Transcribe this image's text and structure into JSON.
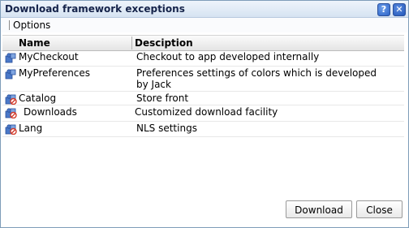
{
  "dialog": {
    "title": "Download framework exceptions",
    "help_glyph": "?",
    "close_glyph": "✕"
  },
  "menu": {
    "options_label": "Options"
  },
  "table": {
    "columns": [
      "Name",
      "Desciption"
    ],
    "rows": [
      {
        "name": "MyCheckout",
        "description": "Checkout to app developed internally",
        "icon": "puzzle-icon"
      },
      {
        "name": "MyPreferences",
        "description": "Preferences settings of colors which is developed by Jack",
        "icon": "puzzle-icon"
      },
      {
        "name": "Catalog",
        "description": "Store front",
        "icon": "puzzle-blocked-icon"
      },
      {
        "name": "Downloads",
        "description": "Customized download facility",
        "icon": "puzzle-blocked-icon"
      },
      {
        "name": "Lang",
        "description": "NLS settings",
        "icon": "puzzle-blocked-icon"
      }
    ]
  },
  "buttons": {
    "download_label": "Download",
    "close_label": "Close"
  },
  "colors": {
    "title_text": "#15234a",
    "puzzle_blue": "#4a79c9",
    "blocked_red": "#d23a2a"
  }
}
